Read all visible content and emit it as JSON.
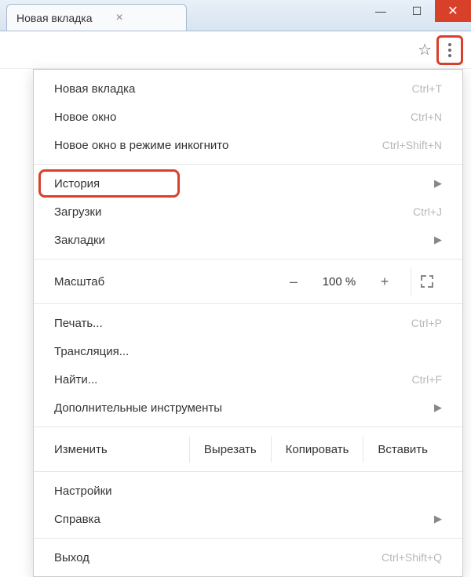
{
  "tab": {
    "title": "Новая вкладка",
    "inactive_hint": ""
  },
  "menu": {
    "new_tab": {
      "label": "Новая вкладка",
      "shortcut": "Ctrl+T"
    },
    "new_window": {
      "label": "Новое окно",
      "shortcut": "Ctrl+N"
    },
    "incognito": {
      "label": "Новое окно в режиме инкогнито",
      "shortcut": "Ctrl+Shift+N"
    },
    "history": {
      "label": "История"
    },
    "downloads": {
      "label": "Загрузки",
      "shortcut": "Ctrl+J"
    },
    "bookmarks": {
      "label": "Закладки"
    },
    "zoom": {
      "label": "Масштаб",
      "value": "100 %",
      "minus": "–",
      "plus": "+"
    },
    "print": {
      "label": "Печать...",
      "shortcut": "Ctrl+P"
    },
    "cast": {
      "label": "Трансляция..."
    },
    "find": {
      "label": "Найти...",
      "shortcut": "Ctrl+F"
    },
    "more_tools": {
      "label": "Дополнительные инструменты"
    },
    "edit": {
      "label": "Изменить",
      "cut": "Вырезать",
      "copy": "Копировать",
      "paste": "Вставить"
    },
    "settings": {
      "label": "Настройки"
    },
    "help": {
      "label": "Справка"
    },
    "exit": {
      "label": "Выход",
      "shortcut": "Ctrl+Shift+Q"
    }
  }
}
